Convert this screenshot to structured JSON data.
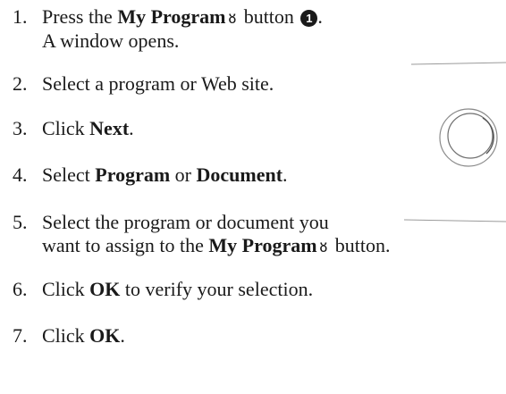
{
  "steps": [
    {
      "num": "1.",
      "pre": "Press the ",
      "bold": "My Program",
      "icon": "person-outline-icon",
      "post": " button",
      "callout": "1",
      "end": ".",
      "line2": "A window opens."
    },
    {
      "num": "2.",
      "text": "Select a program or Web site."
    },
    {
      "num": "3.",
      "pre": "Click ",
      "bold": "Next",
      "post": "."
    },
    {
      "num": "4.",
      "pre": "Select ",
      "bold1": "Program",
      "mid": " or ",
      "bold2": "Document",
      "post": "."
    },
    {
      "num": "5.",
      "line1": "Select the program or document you",
      "pre2": "want to assign to the ",
      "bold": "My Program",
      "icon": "person-outline-icon",
      "post": " button."
    },
    {
      "num": "6.",
      "pre": "Click ",
      "bold": "OK",
      "post": " to verify your selection."
    },
    {
      "num": "7.",
      "pre": "Click ",
      "bold": "OK",
      "post": "."
    }
  ],
  "colors": {
    "text": "#1a1a1a",
    "device_line": "#9a9a9a"
  }
}
